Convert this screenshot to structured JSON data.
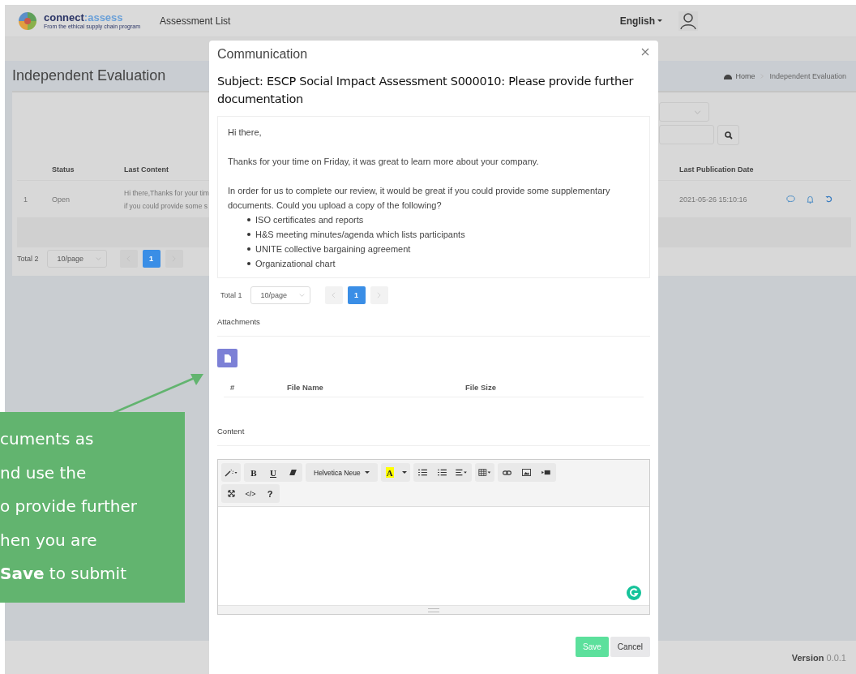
{
  "header": {
    "logo_name": "connect",
    "logo_accent": ":assess",
    "logo_tagline": "From the ethical supply chain program",
    "nav": "Assessment List",
    "language": "English"
  },
  "page": {
    "title": "Independent Evaluation",
    "breadcrumb": [
      "Home",
      "Independent Evaluation"
    ]
  },
  "table": {
    "columns": [
      "Status",
      "Last Content",
      "Last Publication Date"
    ],
    "rows": [
      {
        "index": "1",
        "status": "Open",
        "last_content": [
          "Hi there,Thanks for your tim",
          "if you could provide some s"
        ],
        "date": "2021-05-26 15:10:16"
      }
    ]
  },
  "pagination": {
    "total": "Total 2",
    "page_size": "10/page",
    "pages": [
      {
        "label": "1",
        "selected": true
      }
    ]
  },
  "dialog": {
    "title": "Communication",
    "subject": "Subject: ESCP Social Impact Assessment S000010: Please provide further documentation",
    "message": [
      {
        "kind": "paragraph",
        "text": "Hi there,"
      },
      {
        "kind": "paragraph",
        "text": "Thanks for your time on Friday, it was great to learn more about your company."
      },
      {
        "kind": "paragraph",
        "text": "In order for us to complete our review, it would be great if you could provide some supplementary documents. Could you upload a copy of the following?"
      },
      {
        "kind": "list",
        "items": [
          "ISO certificates and reports",
          "H&S meeting minutes/agenda which lists participants",
          "UNITE collective bargaining agreement",
          "Organizational chart"
        ]
      }
    ],
    "pagination": {
      "total": "Total 1",
      "page_size": "10/page",
      "pages": [
        {
          "label": "1",
          "selected": true
        }
      ]
    },
    "attachments_label": "Attachments",
    "attachment_columns": [
      "#",
      "File Name",
      "File Size"
    ],
    "content_label": "Content",
    "toolbar": {
      "bold": "B",
      "underline": "U",
      "font": "Helvetica Neue",
      "text_style": "A",
      "code": "</>",
      "help": "?"
    },
    "buttons": [
      {
        "label": "Save",
        "kind": "primary"
      },
      {
        "label": "Cancel",
        "kind": "default"
      }
    ]
  },
  "footer": {
    "version_label": "Version",
    "version": "0.0.1"
  },
  "callout": {
    "lines": [
      "cuments as",
      "nd use the",
      "o provide further",
      "hen you are",
      "**Save** to submit"
    ]
  }
}
